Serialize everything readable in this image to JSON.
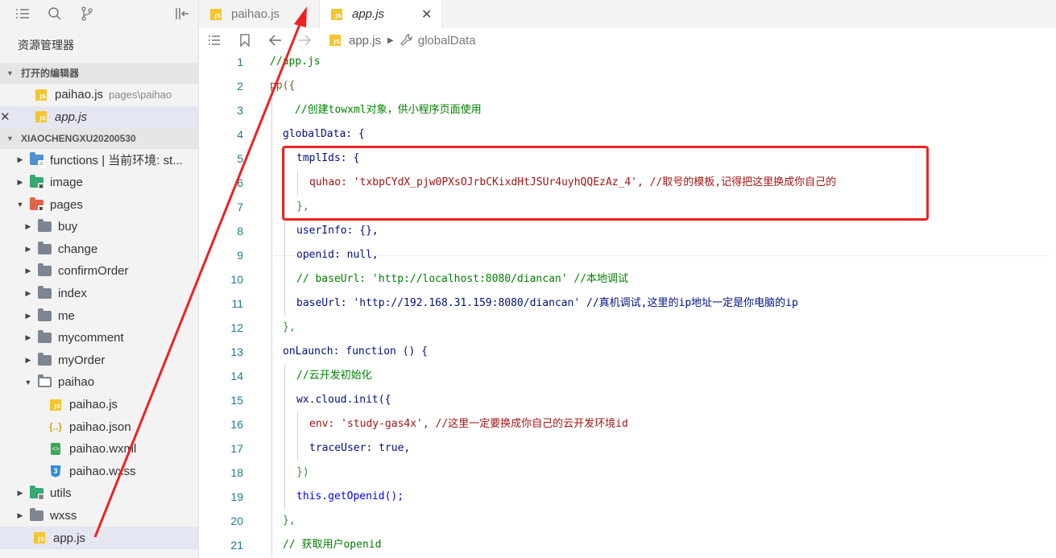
{
  "sidebar": {
    "explorer_title": "资源管理器",
    "open_editors_title": "打开的编辑器",
    "project_title": "XIAOCHENGXU20200530",
    "open_editors": [
      {
        "name": "paihao.js",
        "desc": "pages\\paihao"
      },
      {
        "name": "app.js",
        "desc": ""
      }
    ],
    "tree": [
      {
        "name": "functions | 当前环境: st...",
        "kind": "folder-blue"
      },
      {
        "name": "image",
        "kind": "folder-green"
      },
      {
        "name": "pages",
        "kind": "folder-red"
      },
      {
        "name": "buy",
        "kind": "folder"
      },
      {
        "name": "change",
        "kind": "folder"
      },
      {
        "name": "confirmOrder",
        "kind": "folder"
      },
      {
        "name": "index",
        "kind": "folder"
      },
      {
        "name": "me",
        "kind": "folder"
      },
      {
        "name": "mycomment",
        "kind": "folder"
      },
      {
        "name": "myOrder",
        "kind": "folder"
      },
      {
        "name": "paihao",
        "kind": "folder-open"
      },
      {
        "name": "paihao.js",
        "kind": "js"
      },
      {
        "name": "paihao.json",
        "kind": "json"
      },
      {
        "name": "paihao.wxml",
        "kind": "wxml"
      },
      {
        "name": "paihao.wxss",
        "kind": "wxss"
      },
      {
        "name": "utils",
        "kind": "folder-green"
      },
      {
        "name": "wxss",
        "kind": "folder"
      },
      {
        "name": "app.js",
        "kind": "js"
      }
    ]
  },
  "tabs": [
    {
      "label": "paihao.js",
      "active": false
    },
    {
      "label": "app.js",
      "active": true,
      "close": "✕"
    }
  ],
  "breadcrumb": {
    "file": "app.js",
    "symbol": "globalData"
  },
  "editor": {
    "line_numbers": [
      "1",
      "2",
      "3",
      "4",
      "5",
      "6",
      "7",
      "8",
      "9",
      "10",
      "11",
      "12",
      "13",
      "14",
      "15",
      "16",
      "17",
      "18",
      "19",
      "20",
      "21"
    ],
    "lines": [
      "//app.js",
      "pp({",
      "//创建towxml对象，供小程序页面使用",
      "globalData: {",
      "tmplIds: {",
      "quhao: 'txbpCYdX_pjw0PXsOJrbCKixdHtJSUr4uyhQQEzAz_4', //取号的模板,记得把这里换成你自己的",
      "},",
      "userInfo: {},",
      "openid: null,",
      "// baseUrl: 'http://localhost:8080/diancan' //本地调试",
      "baseUrl: 'http://192.168.31.159:8080/diancan' //真机调试,这里的ip地址一定是你电脑的ip",
      "},",
      "onLaunch: function () {",
      "//云开发初始化",
      "wx.cloud.init({",
      "env: 'study-gas4x', //这里一定要换成你自己的云开发环境id",
      "traceUser: true,",
      "})",
      "this.getOpenid();",
      "},",
      "// 获取用户openid"
    ]
  },
  "colors": {
    "annotation": "#ee2222",
    "line_number": "#237893",
    "comment": "#008000",
    "string": "#a31515"
  }
}
